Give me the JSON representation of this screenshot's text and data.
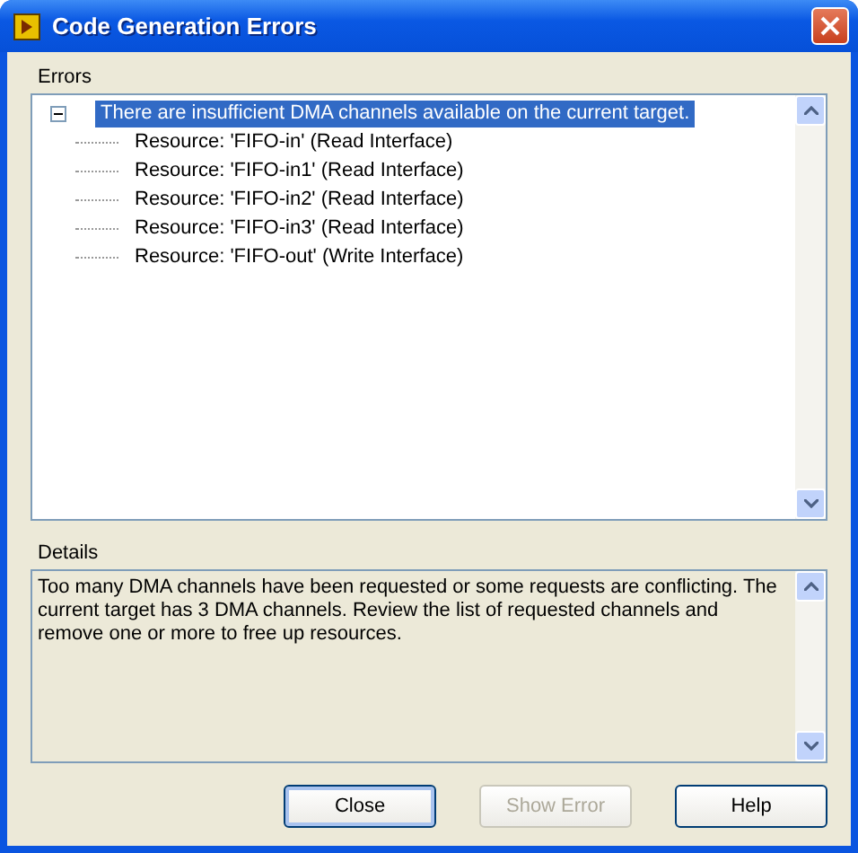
{
  "window": {
    "title": "Code Generation Errors"
  },
  "errors": {
    "label": "Errors",
    "items": [
      {
        "text": "There are insufficient DMA channels available on the current target.",
        "selected": true,
        "expanded": true,
        "children": [
          {
            "text": "Resource: 'FIFO-in' (Read Interface)",
            "selected": false
          },
          {
            "text": "Resource: 'FIFO-in1' (Read Interface)",
            "selected": false
          },
          {
            "text": "Resource: 'FIFO-in2' (Read Interface)",
            "selected": false
          },
          {
            "text": "Resource: 'FIFO-in3' (Read Interface)",
            "selected": false
          },
          {
            "text": "Resource: 'FIFO-out' (Write Interface)",
            "selected": false
          }
        ]
      }
    ]
  },
  "details": {
    "label": "Details",
    "text": "Too many DMA channels have been requested or some requests are conflicting. The current target has 3 DMA channels. Review the list of requested channels and remove one or more to free up resources."
  },
  "buttons": [
    {
      "label": "Close",
      "disabled": false
    },
    {
      "label": "Show Error",
      "disabled": true
    },
    {
      "label": "Help",
      "disabled": false
    }
  ]
}
